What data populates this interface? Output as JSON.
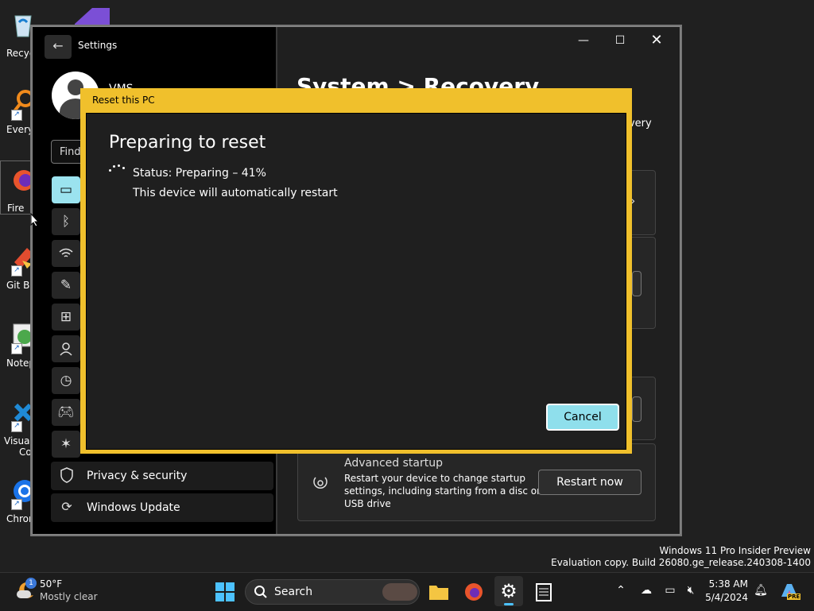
{
  "desktop": {
    "icons": [
      {
        "label": "Recyc",
        "icon": "recycle-bin-icon"
      },
      {
        "label": "Every",
        "icon": "everything-icon"
      },
      {
        "label": "Fire",
        "icon": "firefox-icon"
      },
      {
        "label": "Git B",
        "icon": "git-bash-icon"
      },
      {
        "label": "Notep",
        "icon": "notepad-plus-plus-icon"
      },
      {
        "label": "Visual",
        "label2": "Co",
        "icon": "vscode-icon"
      },
      {
        "label": "Chron",
        "icon": "chrome-icon"
      }
    ],
    "watermark": {
      "line1": "Windows 11 Pro Insider Preview",
      "line2": "Evaluation copy. Build 26080.ge_release.240308-1400"
    }
  },
  "settings": {
    "app_title": "Settings",
    "user_name": "VMS",
    "search_placeholder": "Find",
    "page_title": "System  >  Recovery",
    "page_title_fragment": "overy",
    "nav": {
      "privacy_label": "Privacy & security",
      "update_label": "Windows Update"
    },
    "advanced_startup": {
      "title": "Advanced startup",
      "description_line1": "Restart your device to change startup",
      "description_line2": "settings, including starting from a disc or",
      "description_line3": "USB drive",
      "button_label": "Restart now"
    }
  },
  "dialog": {
    "window_title": "Reset this PC",
    "heading": "Preparing to reset",
    "status": "Status: Preparing – 41%",
    "progress_percent": 41,
    "subtext": "This device will automatically restart",
    "cancel_label": "Cancel"
  },
  "taskbar": {
    "weather_temp": "50°F",
    "weather_desc": "Mostly clear",
    "weather_badge": "1",
    "search_label": "Search",
    "time": "5:38 AM",
    "date": "5/4/2024",
    "copilot_badge": "PRE"
  },
  "colors": {
    "dialog_border": "#f0c02c",
    "accent": "#9be3ef"
  }
}
